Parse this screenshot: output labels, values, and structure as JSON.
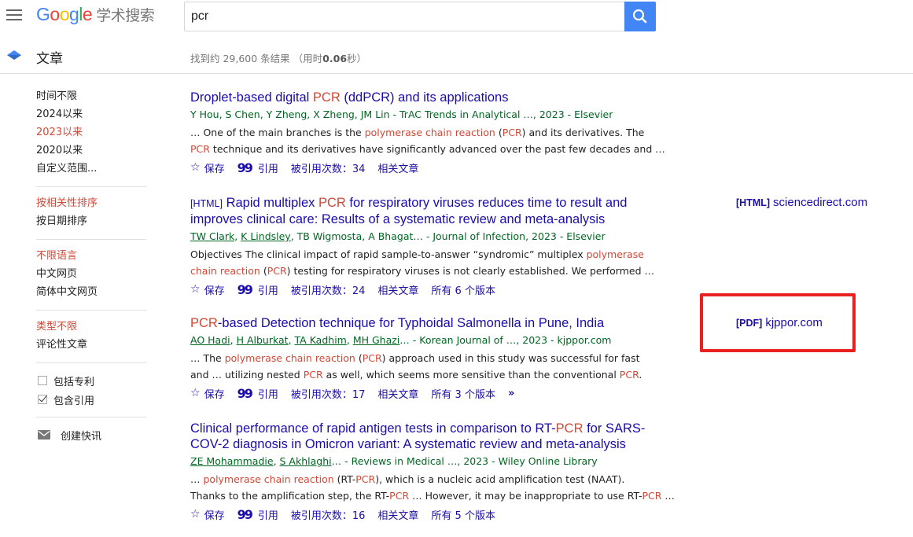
{
  "header": {
    "logo_word": "Google",
    "logo_suffix": "学术搜索",
    "search_value": "pcr"
  },
  "subheader": {
    "section_title": "文章",
    "stats_prefix": "找到约 29,600 条结果 （用时",
    "stats_time": "0.06",
    "stats_suffix": "秒）"
  },
  "sidebar": {
    "time_filters": [
      "时间不限",
      "2024以来",
      "2023以来",
      "2020以来",
      "自定义范围..."
    ],
    "sort_options": [
      "按相关性排序",
      "按日期排序"
    ],
    "language_options": [
      "不限语言",
      "中文网页",
      "简体中文网页"
    ],
    "type_options": [
      "类型不限",
      "评论性文章"
    ],
    "include_patents": "包括专利",
    "include_citations": "包含引用",
    "create_alert": "创建快讯"
  },
  "results": [
    {
      "title_parts": [
        "Droplet-based digital ",
        "PCR",
        " (ddPCR) and its applications"
      ],
      "authors_text": "Y Hou, S Chen, Y Zheng, X Zheng, JM Lin - TrAC Trends in Analytical …, 2023 - Elsevier",
      "snippet_line1": [
        "… One of the main branches is the ",
        "polymerase chain reaction",
        " (",
        "PCR",
        ") and its derivatives. The"
      ],
      "snippet_line2": [
        "PCR",
        " technique and its derivatives have significantly advanced over the past few decades and …"
      ],
      "save": "保存",
      "cite": "引用",
      "cited_by": "被引用次数：34",
      "related": "相关文章"
    },
    {
      "tag": "[HTML]",
      "title_parts": [
        "Rapid multiplex ",
        "PCR",
        " for respiratory viruses reduces time to result and"
      ],
      "title_line2": "improves clinical care: Results of a systematic review and meta-analysis",
      "authors": [
        "TW Clark",
        "K Lindsley",
        "TB Wigmosta",
        "A Bhagat"
      ],
      "authors_suffix": "… - Journal of Infection, 2023 - Elsevier",
      "snippet_line1": [
        "Objectives The clinical impact of rapid sample-to-answer “syndromic” multiplex ",
        "polymerase"
      ],
      "snippet_line2": [
        "chain reaction",
        " (",
        "PCR",
        ") testing for respiratory viruses is not clearly established. We performed …"
      ],
      "save": "保存",
      "cite": "引用",
      "cited_by": "被引用次数：24",
      "related": "相关文章",
      "versions": "所有 6 个版本",
      "side_tag": "[HTML]",
      "side_domain": "sciencedirect.com"
    },
    {
      "title_parts": [
        "PCR",
        "-based Detection technique for Typhoidal Salmonella in Pune, India"
      ],
      "authors": [
        "AO Hadi",
        "H Alburkat",
        "TA Kadhim",
        "MH Ghazi"
      ],
      "authors_suffix": "… - Korean Journal of …, 2023 - kjppor.com",
      "snippet_line1": [
        "… The ",
        "polymerase chain reaction",
        " (",
        "PCR",
        ") approach used in this study was successful for fast"
      ],
      "snippet_line2": [
        "and … utilizing nested ",
        "PCR",
        " as well, which seems more sensitive than the conventional ",
        "PCR",
        "."
      ],
      "save": "保存",
      "cite": "引用",
      "cited_by": "被引用次数：17",
      "related": "相关文章",
      "versions": "所有 3 个版本",
      "side_tag": "[PDF]",
      "side_domain": "kjppor.com"
    },
    {
      "title_parts": [
        "Clinical performance of rapid antigen tests in comparison to RT-",
        "PCR",
        " for SARS-"
      ],
      "title_line2": "COV-2 diagnosis in Omicron variant: A systematic review and meta-analysis",
      "authors": [
        "ZE Mohammadie",
        "S Akhlaghi"
      ],
      "authors_suffix": "… - Reviews in Medical …, 2023 - Wiley Online Library",
      "snippet_line1": [
        "… ",
        "polymerase chain reaction",
        " (RT-",
        "PCR",
        "), which is a nucleic acid amplification test (NAAT)."
      ],
      "snippet_line2": [
        "Thanks to the amplification step, the RT-",
        "PCR",
        " … However, it may be inappropriate to use RT-",
        "PCR",
        " …"
      ],
      "save": "保存",
      "cite": "引用",
      "cited_by": "被引用次数：16",
      "related": "相关文章",
      "versions": "所有 5 个版本"
    }
  ],
  "colors": {
    "link": "#1a0dab",
    "highlight": "#d14836",
    "green": "#006621",
    "annotation_box": "#e8201f"
  }
}
